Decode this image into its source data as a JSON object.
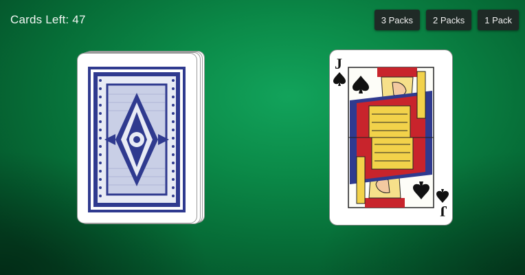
{
  "status": {
    "cards_left_label": "Cards Left:",
    "cards_left_value": "47"
  },
  "pack_buttons": [
    {
      "label": "3 Packs"
    },
    {
      "label": "2 Packs"
    },
    {
      "label": "1 Pack"
    }
  ],
  "deck": {
    "back_color": "#2f3a8f",
    "icon": "card-deck-back-icon"
  },
  "face_up_card": {
    "rank": "J",
    "suit": "spades",
    "suit_symbol": "♠",
    "icon": "jack-of-spades-icon"
  },
  "colors": {
    "felt": "#0b8a48",
    "button_bg": "#1f2a26",
    "card_back_blue": "#2f3a8f"
  }
}
